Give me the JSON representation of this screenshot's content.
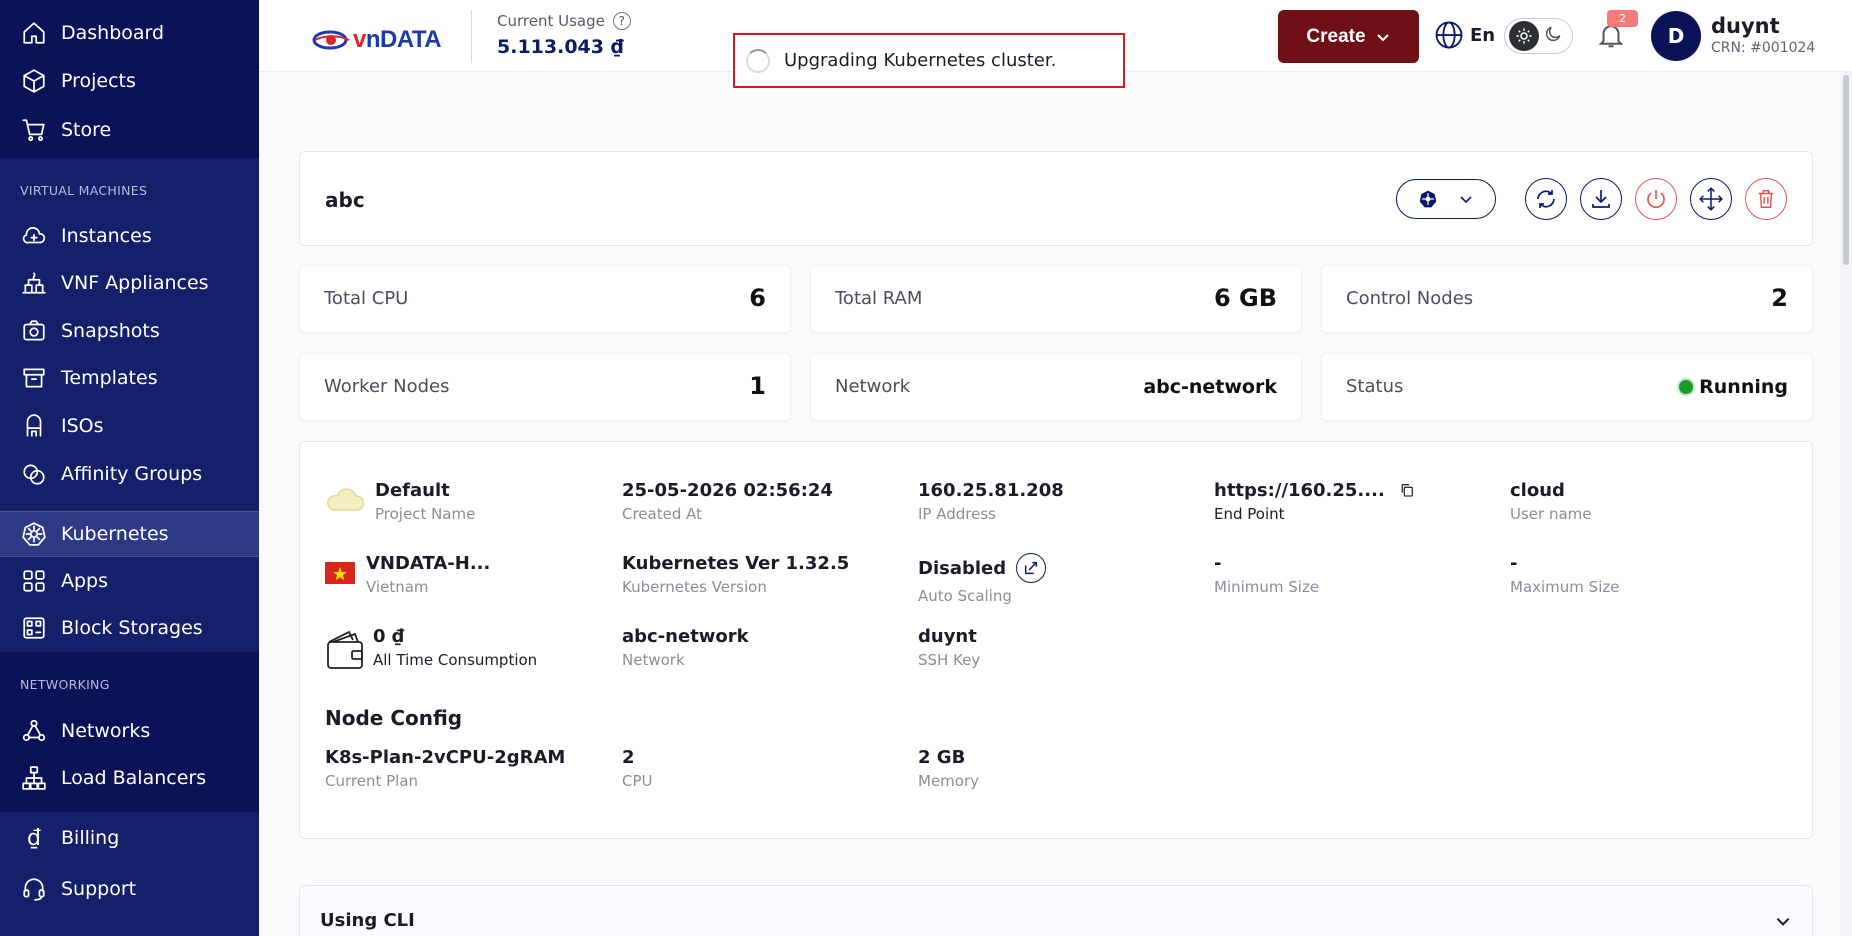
{
  "sidebar": {
    "top_items": [
      {
        "label": "Dashboard",
        "icon": "home-icon"
      },
      {
        "label": "Projects",
        "icon": "cube-icon"
      },
      {
        "label": "Store",
        "icon": "cart-icon"
      }
    ],
    "section_vm": "VIRTUAL MACHINES",
    "vm_items": [
      {
        "label": "Instances",
        "icon": "cloud-icon"
      },
      {
        "label": "VNF Appliances",
        "icon": "firewall-icon"
      },
      {
        "label": "Snapshots",
        "icon": "camera-icon"
      },
      {
        "label": "Templates",
        "icon": "archive-icon"
      },
      {
        "label": "ISOs",
        "icon": "disc-icon"
      },
      {
        "label": "Affinity Groups",
        "icon": "affinity-icon"
      },
      {
        "label": "Kubernetes",
        "icon": "kubernetes-icon"
      },
      {
        "label": "Apps",
        "icon": "apps-icon"
      },
      {
        "label": "Block Storages",
        "icon": "storage-icon"
      }
    ],
    "section_net": "NETWORKING",
    "net_items": [
      {
        "label": "Networks",
        "icon": "network-icon"
      },
      {
        "label": "Load Balancers",
        "icon": "load-balancer-icon"
      }
    ],
    "bottom_items": [
      {
        "label": "Billing",
        "icon": "billing-icon"
      },
      {
        "label": "Support",
        "icon": "headset-icon"
      }
    ],
    "active": "Kubernetes"
  },
  "header": {
    "logo_prefix": "v",
    "logo_text": "nDATA",
    "usage_label": "Current Usage",
    "usage_value": "5.113.043 ₫",
    "create_label": "Create",
    "language": "En",
    "notification_count": "2",
    "avatar_initial": "D",
    "user_name": "duynt",
    "user_crn": "CRN: #001024"
  },
  "toast": {
    "message": "Upgrading Kubernetes cluster."
  },
  "cluster": {
    "name": "abc"
  },
  "stats": {
    "total_cpu_label": "Total CPU",
    "total_cpu_value": "6",
    "total_ram_label": "Total RAM",
    "total_ram_value": "6 GB",
    "control_nodes_label": "Control Nodes",
    "control_nodes_value": "2",
    "worker_nodes_label": "Worker Nodes",
    "worker_nodes_value": "1",
    "network_label": "Network",
    "network_value": "abc-network",
    "status_label": "Status",
    "status_value": "Running"
  },
  "details": {
    "project_name": {
      "value": "Default",
      "key": "Project Name"
    },
    "created_at": {
      "value": "25-05-2026 02:56:24",
      "key": "Created At"
    },
    "ip_address": {
      "value": "160.25.81.208",
      "key": "IP Address"
    },
    "end_point": {
      "value": "https://160.25....",
      "key": "End Point"
    },
    "user_name": {
      "value": "cloud",
      "key": "User name"
    },
    "zone": {
      "value": "VNDATA-H...",
      "key": "Vietnam"
    },
    "k8s_version": {
      "value": "Kubernetes Ver 1.32.5",
      "key": "Kubernetes Version"
    },
    "auto_scaling": {
      "value": "Disabled",
      "key": "Auto Scaling"
    },
    "min_size": {
      "value": "-",
      "key": "Minimum Size"
    },
    "max_size": {
      "value": "-",
      "key": "Maximum Size"
    },
    "consumption": {
      "value": "0 ₫",
      "key": "All Time Consumption"
    },
    "network": {
      "value": "abc-network",
      "key": "Network"
    },
    "ssh_key": {
      "value": "duynt",
      "key": "SSH Key"
    },
    "node_config_title": "Node Config",
    "plan": {
      "value": "K8s-Plan-2vCPU-2gRAM",
      "key": "Current Plan"
    },
    "cpu": {
      "value": "2",
      "key": "CPU"
    },
    "memory": {
      "value": "2 GB",
      "key": "Memory"
    }
  },
  "cli": {
    "title": "Using CLI"
  },
  "colors": {
    "sidebar_bg": "#0b1258",
    "accent": "#6e1016",
    "running": "#1b9a2a"
  }
}
